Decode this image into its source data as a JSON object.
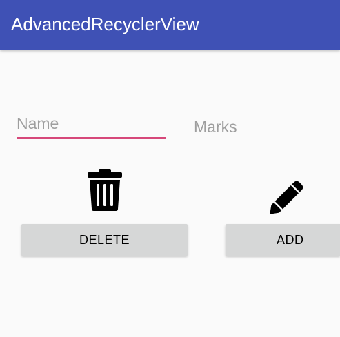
{
  "app_bar": {
    "title": "AdvancedRecyclerView",
    "color": "#3f51b5"
  },
  "form": {
    "name_placeholder": "Name",
    "name_value": "",
    "marks_placeholder": "Marks",
    "marks_value": "",
    "name_accent_color": "#d6487a"
  },
  "actions": {
    "delete_icon": "trash-icon",
    "delete_label": "DELETE",
    "add_icon": "pencil-icon",
    "add_label": "ADD"
  }
}
